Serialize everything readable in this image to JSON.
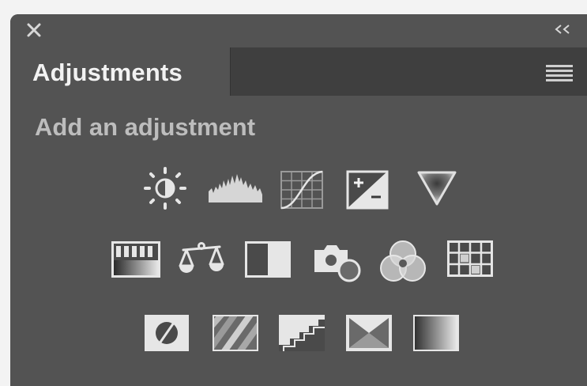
{
  "panel": {
    "tab_label": "Adjustments",
    "section_title": "Add an adjustment"
  },
  "colors": {
    "panel_bg": "#535353",
    "tab_strip_bg": "#3f3f3f",
    "text": "#f2f2f2",
    "subtitle": "#bdbdbd",
    "icon": "#cfcfcf"
  },
  "icons": {
    "row1": [
      "brightness-contrast-icon",
      "levels-icon",
      "curves-icon",
      "exposure-icon",
      "vibrance-icon"
    ],
    "row2": [
      "hue-saturation-icon",
      "color-balance-icon",
      "black-white-icon",
      "photo-filter-icon",
      "channel-mixer-icon",
      "color-lookup-icon"
    ],
    "row3": [
      "invert-icon",
      "posterize-icon",
      "threshold-icon",
      "selective-color-icon",
      "gradient-map-icon"
    ]
  }
}
